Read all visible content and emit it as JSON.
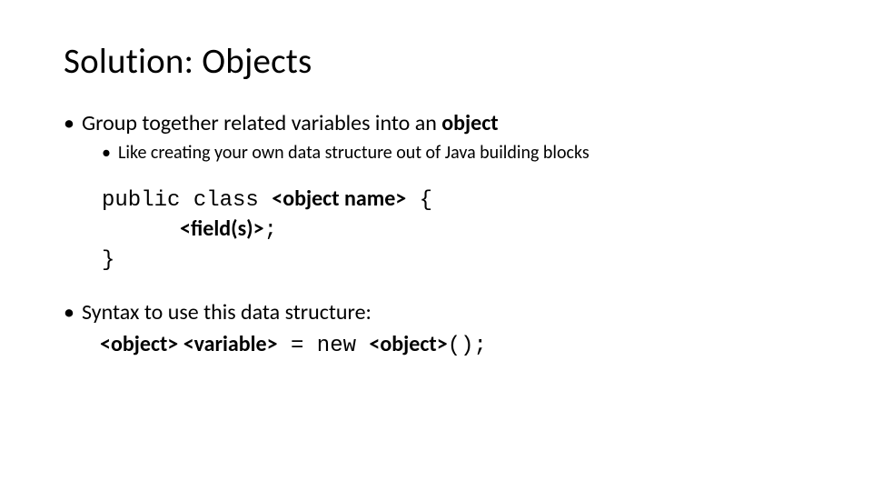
{
  "title": "Solution: Objects",
  "bullets": {
    "b1_prefix": "Group together related variables into an ",
    "b1_bold": "object",
    "b1_sub": "Like creating your own data structure out of Java building blocks",
    "b2": "Syntax to use this data structure:"
  },
  "code": {
    "l1_mono1": "public class ",
    "l1_bold": "<object name>",
    "l1_mono2": " {",
    "l2_bold": "<field(s)>",
    "l2_mono": ";",
    "l3_mono": "}"
  },
  "syntax": {
    "p1_bold": "<object>",
    "sp": "  ",
    "p2_bold": "<variable>",
    "mono_eq": " = new ",
    "p3_bold": "<object>",
    "mono_end": "();"
  }
}
